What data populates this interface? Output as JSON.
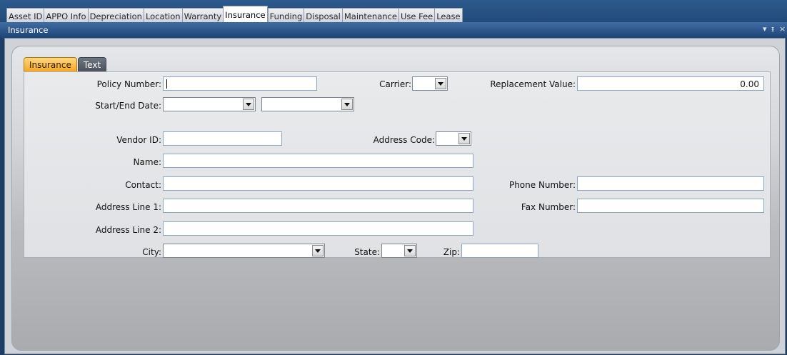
{
  "top_tabs": [
    "Asset ID",
    "APPO Info",
    "Depreciation",
    "Location",
    "Warranty",
    "Insurance",
    "Funding",
    "Disposal",
    "Maintenance",
    "Use Fee",
    "Lease"
  ],
  "active_top_tab": "Insurance",
  "panel": {
    "title": "Insurance",
    "controls": {
      "dropdown": "▾",
      "pin": "ᵻ",
      "close": "×"
    }
  },
  "sub_tabs": [
    "Insurance",
    "Text"
  ],
  "form": {
    "policy_number_label": "Policy Number:",
    "policy_number_value": "",
    "carrier_label": "Carrier:",
    "carrier_value": "",
    "replacement_value_label": "Replacement Value:",
    "replacement_value": "0.00",
    "start_end_date_label": "Start/End Date:",
    "start_date_value": "",
    "end_date_value": "",
    "vendor_id_label": "Vendor ID:",
    "vendor_id_value": "",
    "address_code_label": "Address Code:",
    "address_code_value": "",
    "name_label": "Name:",
    "name_value": "",
    "contact_label": "Contact:",
    "contact_value": "",
    "phone_number_label": "Phone Number:",
    "phone_number_value": "",
    "address_line1_label": "Address Line 1:",
    "address_line1_value": "",
    "fax_number_label": "Fax Number:",
    "fax_number_value": "",
    "address_line2_label": "Address Line 2:",
    "address_line2_value": "",
    "city_label": "City:",
    "city_value": "",
    "state_label": "State:",
    "state_value": "",
    "zip_label": "Zip:",
    "zip_value": ""
  }
}
